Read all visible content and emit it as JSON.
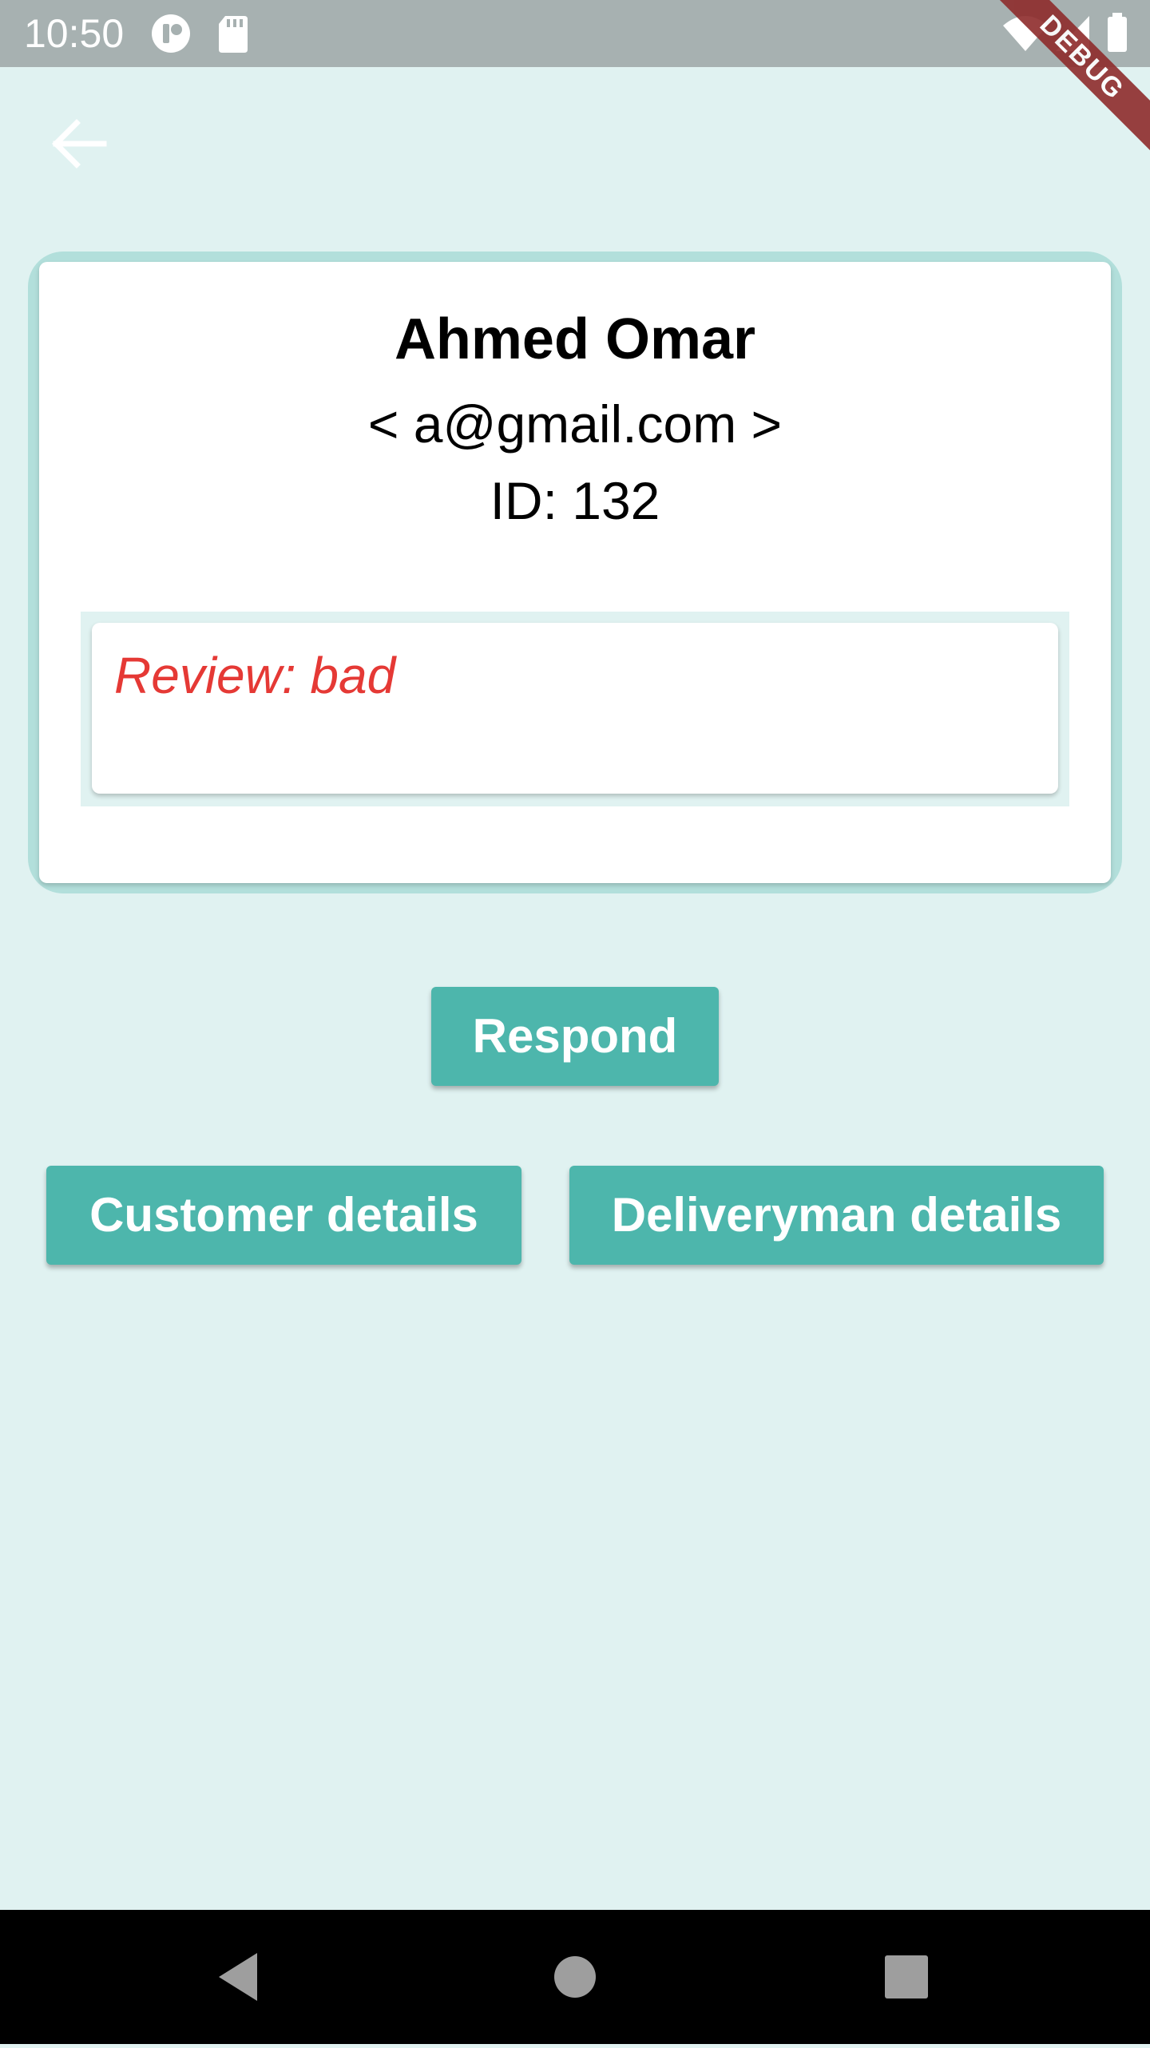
{
  "status_bar": {
    "time": "10:50",
    "icons": [
      "app-notification-icon",
      "sd-card-icon",
      "wifi-icon",
      "cell-signal-icon",
      "battery-icon"
    ],
    "debug_label": "DEBUG"
  },
  "app_bar": {
    "back_icon": "arrow-back-icon"
  },
  "profile": {
    "name": "Ahmed Omar",
    "email": "< a@gmail.com >",
    "id": "ID: 132",
    "review": "Review: bad"
  },
  "actions": {
    "respond_label": "Respond",
    "customer_details_label": "Customer details",
    "deliveryman_details_label": "Deliveryman details"
  },
  "colors": {
    "background": "#e0f2f1",
    "button": "#4db6ac",
    "card_border": "#b2dfdb",
    "review_text": "#e53935",
    "status_bar": "#a7b1b1"
  },
  "nav_bar": {
    "icons": [
      "back-triangle-icon",
      "home-circle-icon",
      "recents-square-icon"
    ]
  }
}
